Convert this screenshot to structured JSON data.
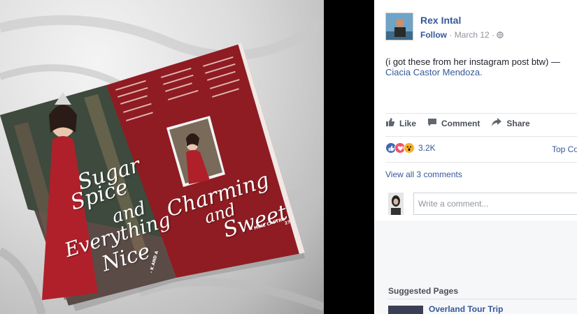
{
  "post": {
    "author": "Rex Intal",
    "follow_label": "Follow",
    "date": "March 12",
    "separator": "·",
    "text": "(i got these from her instagram post btw) —",
    "tagged": "Ciacia Castor Mendoza."
  },
  "magazine": {
    "left_headline": [
      "Sugar",
      "Spice",
      "and",
      "Everything",
      "Nice"
    ],
    "left_credit": "- K AND A",
    "right_headline": [
      "Charming",
      "and",
      "Sweet"
    ],
    "right_credit": "- MIKE CASTRO",
    "page_number": "27"
  },
  "actions": {
    "like": "Like",
    "comment": "Comment",
    "share": "Share"
  },
  "reactions": {
    "count": "3.2K",
    "top_comments": "Top Co",
    "types": [
      "like",
      "love",
      "wow"
    ],
    "colors": {
      "like": "#4267b2",
      "love": "#f25268",
      "wow": "#f7b125"
    }
  },
  "comments": {
    "view_all": "View all 3 comments",
    "placeholder": "Write a comment..."
  },
  "suggested": {
    "title": "Suggested Pages",
    "first_page": "Overland Tour Trip"
  }
}
